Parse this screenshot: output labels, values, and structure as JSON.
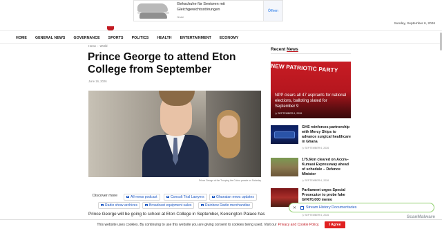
{
  "ad": {
    "title": "Gehschuhe für Senioren mit Gleichgewichtsstörungen",
    "sponsor": "Hmaki",
    "cta": "Öffnen"
  },
  "header": {
    "date": "Sunday, September 6, 2026"
  },
  "nav": {
    "items": [
      "HOME",
      "GENERAL NEWS",
      "GOVERNANCE",
      "SPORTS",
      "POLITICS",
      "HEALTH",
      "ENTERTAINMENT",
      "ECONOMY"
    ]
  },
  "article": {
    "breadcrumb": [
      "Home",
      "World"
    ],
    "title": "Prince George to attend Eton College from September",
    "date": "June 16, 2026",
    "caption": "Prince George at the Trooping the Colour parade on Saturday",
    "discover_label": "Discover more",
    "chips": [
      "All-news podcast",
      "Consult Trial Lawyers",
      "Ghanaian news updates",
      "Radio show archives",
      "Broadcast equipment sales",
      "Rainbow Radio merchandise"
    ],
    "body_start": "Prince George will be going to school at Eton College in September, Kensington Palace has"
  },
  "sidebar": {
    "heading_prefix": "Recent",
    "heading_highlight": "News",
    "featured": {
      "banner": "NEW PATRIOTIC PARTY",
      "title": "NPP clears all 47 aspirants for national elections, balloting slated for September 9",
      "date": "SEPTEMBER 6, 2026"
    },
    "items": [
      {
        "title": "GHS reinforces partnership with Mercy Ships to advance surgical healthcare in Ghana",
        "date": "SEPTEMBER 6, 2026"
      },
      {
        "title": "175.6km cleared on Accra–Kumasi Expressway ahead of schedule – Defence Minister",
        "date": "SEPTEMBER 6, 2026"
      },
      {
        "title": "Parliament urges Special Prosecutor to probe fake GH¢70,000 memo",
        "date": "SEPTEMBER 6, 2026"
      }
    ]
  },
  "popup": {
    "text": "Stream History Documentaries"
  },
  "watermark": "ScanMalware",
  "cookie": {
    "text": "This website uses cookies. By continuing to use this website you are giving consent to cookies being used. Visit our",
    "link": "Privacy and Cookie Policy.",
    "button": "I Agree"
  },
  "colors": {
    "accent": "#c21a22",
    "link": "#1a57c4",
    "cookie_button": "#e02020"
  }
}
